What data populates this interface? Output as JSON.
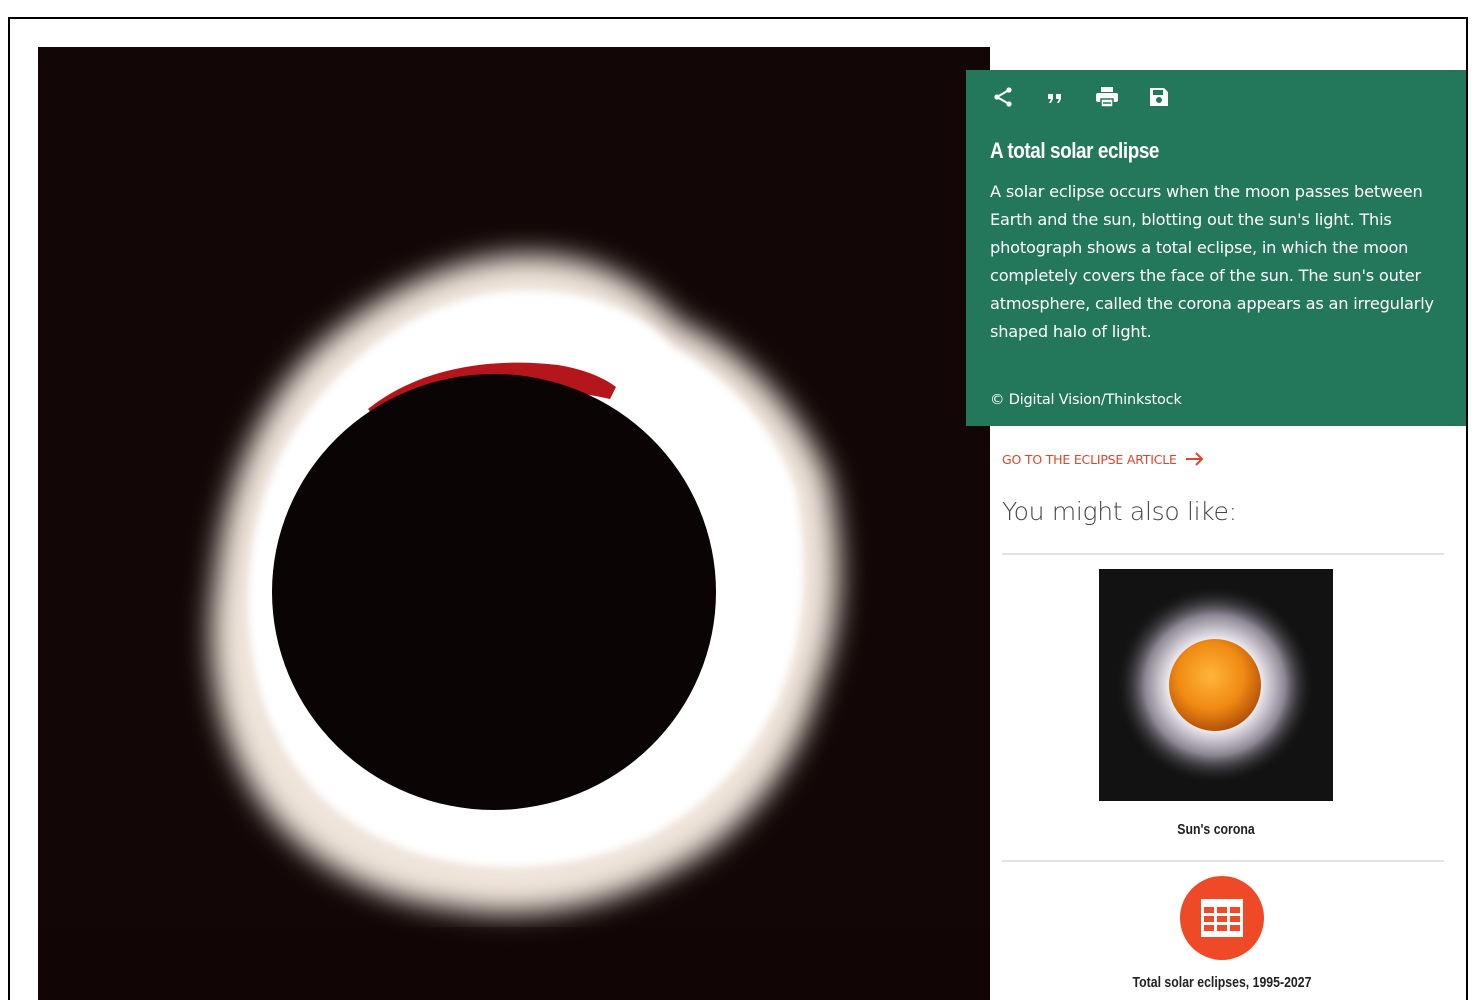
{
  "toolbar": {
    "share_icon": "share-icon",
    "cite_icon": "quote-icon",
    "print_icon": "print-icon",
    "save_icon": "save-icon"
  },
  "caption": {
    "title": "A total solar eclipse",
    "body": "A solar eclipse occurs when the moon passes between Earth and the sun, blotting out the sun's light. This photograph shows a total eclipse, in which the moon completely covers the face of the sun. The sun's outer atmosphere, called the corona appears as an irregularly shaped halo of light.",
    "credit": "© Digital Vision/Thinkstock"
  },
  "article_link": {
    "label": "GO TO THE ECLIPSE ARTICLE"
  },
  "related": {
    "heading": "You might also like:",
    "items": [
      {
        "label": "Sun's corona",
        "icon": "corona-thumbnail"
      },
      {
        "label": "Total solar eclipses, 1995-2027",
        "icon": "table-icon"
      }
    ]
  },
  "colors": {
    "panel_green": "#23775a",
    "accent_orange": "#ef4a27",
    "link_red": "#e0442a"
  }
}
